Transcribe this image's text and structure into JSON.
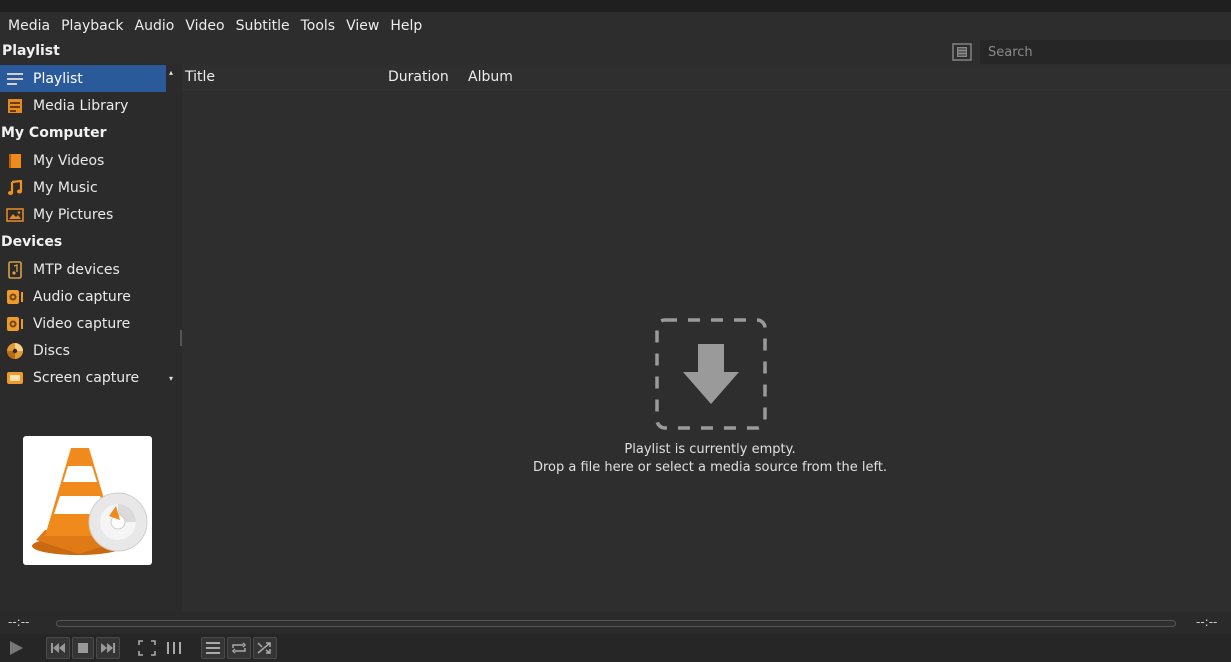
{
  "menu": [
    "Media",
    "Playback",
    "Audio",
    "Video",
    "Subtitle",
    "Tools",
    "View",
    "Help"
  ],
  "header": {
    "title": "Playlist"
  },
  "search": {
    "placeholder": "Search"
  },
  "sidebar": {
    "items": [
      {
        "label": "Playlist",
        "icon": "playlist-icon",
        "selected": true
      },
      {
        "label": "Media Library",
        "icon": "media-library-icon"
      }
    ],
    "computer_title": "My Computer",
    "computer": [
      {
        "label": "My Videos",
        "icon": "video-folder-icon"
      },
      {
        "label": "My Music",
        "icon": "music-note-icon"
      },
      {
        "label": "My Pictures",
        "icon": "picture-icon"
      }
    ],
    "devices_title": "Devices",
    "devices": [
      {
        "label": "MTP devices",
        "icon": "mtp-device-icon"
      },
      {
        "label": "Audio capture",
        "icon": "audio-capture-icon"
      },
      {
        "label": "Video capture",
        "icon": "video-capture-icon"
      },
      {
        "label": "Discs",
        "icon": "disc-icon"
      },
      {
        "label": "Screen capture",
        "icon": "screen-capture-icon"
      }
    ]
  },
  "columns": [
    "Title",
    "Duration",
    "Album"
  ],
  "empty": {
    "line1": "Playlist is currently empty.",
    "line2": "Drop a file here or select a media source from the left."
  },
  "seek": {
    "elapsed": "--:--",
    "remaining": "--:--",
    "position": 0
  },
  "colors": {
    "accent": "#2a5a9a",
    "cone_orange": "#f08a1c",
    "background": "#2e2e2e"
  }
}
